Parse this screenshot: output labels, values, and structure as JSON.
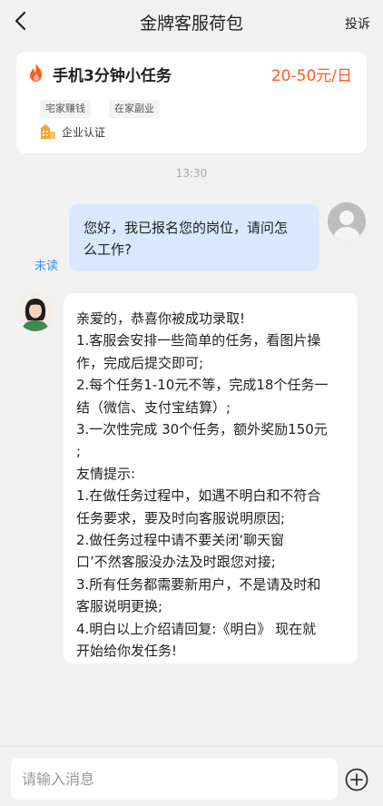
{
  "header": {
    "title": "金牌客服荷包",
    "report_label": "投诉",
    "back_icon": "chevron-left-icon"
  },
  "job_card": {
    "title": "手机3分钟小任务",
    "salary": "20-50元/日",
    "tags": [
      "宅家赚钱",
      "在家副业"
    ],
    "certification": "企业认证",
    "icons": {
      "fire": "fire-icon",
      "cert": "building-icon"
    },
    "colors": {
      "salary": "#ff5a1f",
      "fire": "#ff5a1f",
      "cert": "#f5a623"
    }
  },
  "chat": {
    "timestamp": "13:30",
    "outgoing": {
      "lines": [
        "您好，我已报名您的岗位，请问怎",
        "么工作?"
      ],
      "status": "未读"
    },
    "incoming": {
      "lines": [
        "亲爱的，恭喜你被成功录取!",
        "1.客服会安排一些简单的任务，看图片操",
        "作，完成后提交即可;",
        "2.每个任务1-10元不等，完成18个任务一",
        "结（微信、支付宝结算）;",
        "3.一次性完成 30个任务，额外奖励150元",
        ";",
        "友情提示:",
        "1.在做任务过程中，如遇不明白和不符合",
        "任务要求，要及时向客服说明原因;",
        "2.做任务过程中请不要关闭‘聊天窗",
        "口’不然客服没办法及时跟您对接;",
        "3.所有任务都需要新用户，不是请及时和",
        "客服说明更换;",
        "4.明白以上介绍请回复:《明白》 现在就",
        "开始给你发任务!"
      ]
    },
    "colors": {
      "outgoing_bubble": "#d9e8ff",
      "unread": "#3e8ef7"
    }
  },
  "composer": {
    "placeholder": "请输入消息",
    "value": "",
    "add_icon": "plus-circle-icon"
  }
}
